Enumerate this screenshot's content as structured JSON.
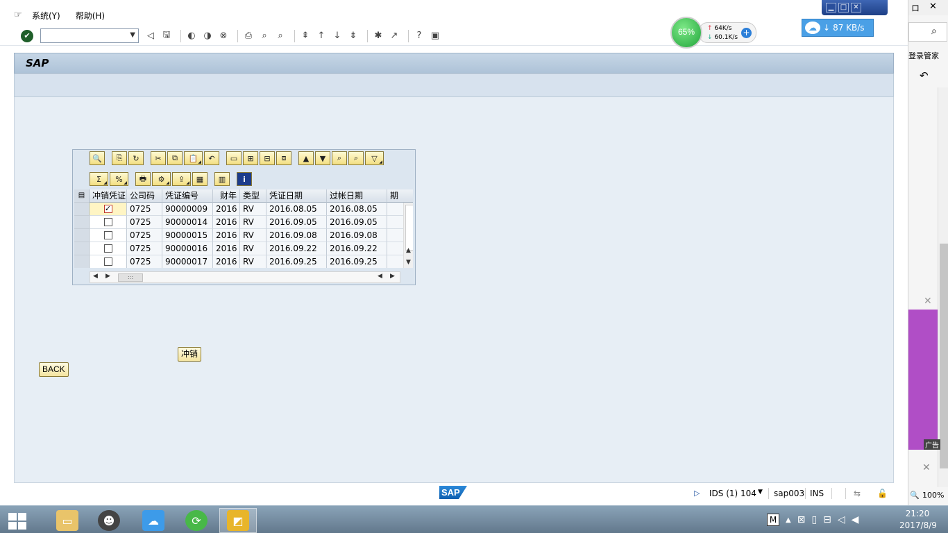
{
  "menu": {
    "items": [
      "系统(Y)",
      "帮助(H)"
    ]
  },
  "title": "SAP",
  "alv": {
    "toolbar_row1": [
      "🔍",
      "⎘",
      "↻",
      "✂",
      "⧉",
      "📋",
      "↶",
      "▭",
      "⊞",
      "⊟",
      "⧈",
      "▲",
      "▼",
      "⌕",
      "⌕",
      "▽"
    ],
    "toolbar_row2": [
      "Σ",
      "%",
      "🖶",
      "⚙",
      "⇪",
      "▦",
      "▥",
      "i"
    ],
    "columns": [
      "冲销凭证",
      "公司码",
      "凭证编号",
      "财年",
      "类型",
      "凭证日期",
      "过帐日期",
      "期"
    ],
    "rows": [
      {
        "checked": true,
        "company": "0725",
        "doc": "90000009",
        "year": "2016",
        "type": "RV",
        "doc_date": "2016.08.05",
        "post_date": "2016.08.05"
      },
      {
        "checked": false,
        "company": "0725",
        "doc": "90000014",
        "year": "2016",
        "type": "RV",
        "doc_date": "2016.09.05",
        "post_date": "2016.09.05"
      },
      {
        "checked": false,
        "company": "0725",
        "doc": "90000015",
        "year": "2016",
        "type": "RV",
        "doc_date": "2016.09.08",
        "post_date": "2016.09.08"
      },
      {
        "checked": false,
        "company": "0725",
        "doc": "90000016",
        "year": "2016",
        "type": "RV",
        "doc_date": "2016.09.22",
        "post_date": "2016.09.22"
      },
      {
        "checked": false,
        "company": "0725",
        "doc": "90000017",
        "year": "2016",
        "type": "RV",
        "doc_date": "2016.09.25",
        "post_date": "2016.09.25"
      }
    ],
    "hscroll_thumb": ":::"
  },
  "buttons": {
    "reverse": "冲销",
    "back": "BACK"
  },
  "status": {
    "logo": "SAP",
    "session": "IDS (1) 104",
    "server": "sap003",
    "mode": "INS"
  },
  "net": {
    "percent": "65%",
    "up": "64K/s",
    "down": "60.1K/s",
    "plus": "+"
  },
  "download": {
    "speed": "87 KB/s"
  },
  "right_strip": {
    "password_mgr": "登录管家",
    "ad": "广告",
    "zoom": "100%"
  },
  "clock": {
    "time": "21:20",
    "date": "2017/8/9"
  },
  "tray": {
    "ime": "M"
  }
}
